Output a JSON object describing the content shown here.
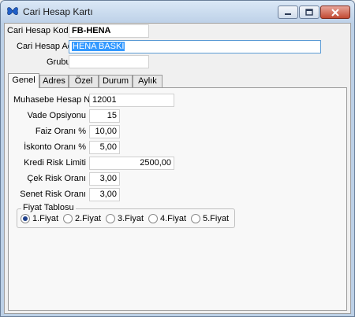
{
  "window": {
    "title": "Cari Hesap Kartı"
  },
  "header_fields": {
    "code": {
      "label": "Cari Hesap Kodu",
      "value": "FB-HENA"
    },
    "name": {
      "label": "Cari Hesap Adı",
      "value": "HENA BASKI"
    },
    "group": {
      "label": "Grubu",
      "value": ""
    }
  },
  "tabs": [
    {
      "label": "Genel",
      "active": true
    },
    {
      "label": "Adres"
    },
    {
      "label": "Özel"
    },
    {
      "label": "Durum"
    },
    {
      "label": "Aylık"
    }
  ],
  "genel": {
    "muhasebe": {
      "label": "Muhasebe Hesap No",
      "value": "12001"
    },
    "vade": {
      "label": "Vade Opsiyonu",
      "value": "15"
    },
    "faiz": {
      "label": "Faiz Oranı %",
      "value": "10,00"
    },
    "iskonto": {
      "label": "İskonto Oranı %",
      "value": "5,00"
    },
    "kredi": {
      "label": "Kredi Risk Limiti",
      "value": "2500,00"
    },
    "cek": {
      "label": "Çek Risk Oranı",
      "value": "3,00"
    },
    "senet": {
      "label": "Senet Risk Oranı",
      "value": "3,00"
    }
  },
  "fiyat": {
    "title": "Fiyat Tablosu",
    "options": [
      "1.Fiyat",
      "2.Fiyat",
      "3.Fiyat",
      "4.Fiyat",
      "5.Fiyat"
    ],
    "selected": "1.Fiyat"
  }
}
